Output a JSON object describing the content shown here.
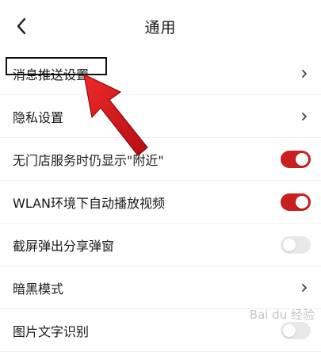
{
  "header": {
    "title": "通用",
    "back_icon": "chevron-left-icon"
  },
  "settings": [
    {
      "label": "消息推送设置",
      "control": "chevron"
    },
    {
      "label": "隐私设置",
      "control": "chevron"
    },
    {
      "label": "无门店服务时仍显示\"附近\"",
      "control": "toggle",
      "state": "on"
    },
    {
      "label": "WLAN环境下自动播放视频",
      "control": "toggle",
      "state": "on"
    },
    {
      "label": "截屏弹出分享弹窗",
      "control": "toggle",
      "state": "off"
    },
    {
      "label": "暗黑模式",
      "control": "chevron"
    },
    {
      "label": "图片文字识别",
      "control": "toggle",
      "state": "off"
    }
  ],
  "colors": {
    "toggle_on": "#c8201f",
    "toggle_off": "#e8e8e8",
    "arrow": "#d9141a"
  },
  "watermark": {
    "text": "Bai du 经验"
  }
}
